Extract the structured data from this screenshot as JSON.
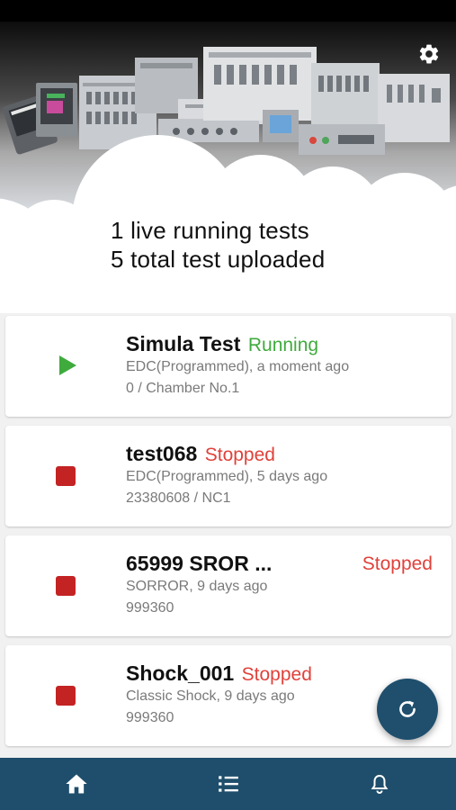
{
  "summary": {
    "live_line": "1 live running tests",
    "total_line": "5 total test uploaded"
  },
  "tests": [
    {
      "name": "Simula Test",
      "status": "Running",
      "detail": "EDC(Programmed), a moment ago",
      "device": "0 / Chamber No.1"
    },
    {
      "name": "test068",
      "status": "Stopped",
      "detail": "EDC(Programmed), 5 days ago",
      "device": "23380608 / NC1"
    },
    {
      "name": "65999 SROR ...",
      "status": "Stopped",
      "detail": "SORROR, 9 days ago",
      "device": "999360"
    },
    {
      "name": "Shock_001",
      "status": "Stopped",
      "detail": "Classic Shock, 9 days ago",
      "device": "999360"
    }
  ],
  "icons": {
    "settings": "gear-icon",
    "running": "play-icon",
    "stopped": "stop-icon",
    "refresh": "refresh-icon",
    "nav_home": "home-icon",
    "nav_list": "list-icon",
    "nav_notifications": "bell-icon"
  },
  "colors": {
    "running": "#3fab3d",
    "stopped": "#e0413a",
    "stop_square": "#c32323",
    "nav_bar": "#1e4e6b",
    "fab": "#1f4f6d"
  }
}
